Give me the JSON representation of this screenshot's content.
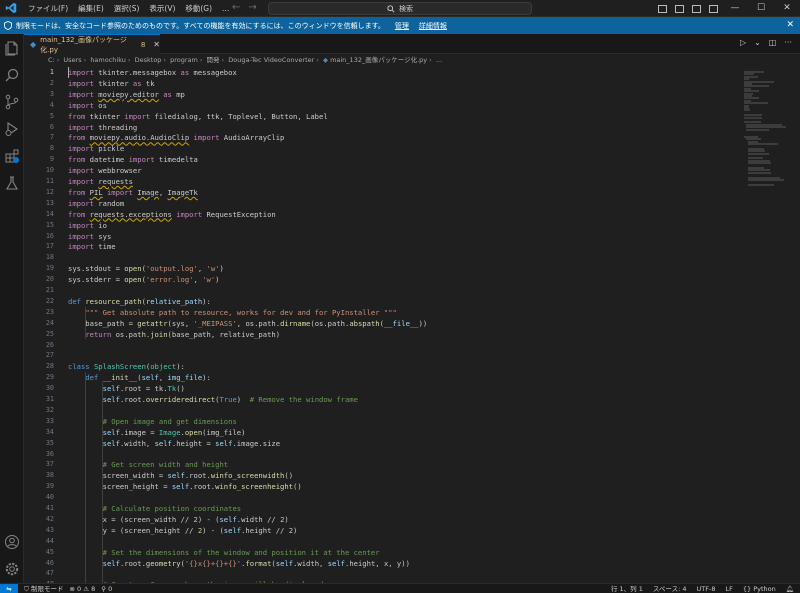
{
  "titlebar": {
    "menus": [
      "ファイル(F)",
      "編集(E)",
      "選択(S)",
      "表示(V)",
      "移動(G)",
      "..."
    ],
    "search_placeholder": "検索"
  },
  "banner": {
    "text": "制限モードは、安全なコード参照のためのものです。すべての機能を有効にするには、このウィンドウを信頼します。",
    "manage": "管理",
    "details": "詳細情報"
  },
  "tab": {
    "filename": "main_132_画像パッケージ化.py",
    "problems": "8"
  },
  "breadcrumb": [
    "C:",
    "Users",
    "hamochiku",
    "Desktop",
    "program",
    "開発",
    "Douga-Tec VideoConverter",
    "main_132_画像パッケージ化.py",
    "..."
  ],
  "editor": {
    "first_line_number": 1,
    "lines": [
      [
        [
          "import",
          "k"
        ],
        [
          " tkinter.messagebox ",
          ""
        ],
        [
          "as",
          "k"
        ],
        [
          " messagebox",
          ""
        ]
      ],
      [
        [
          "import",
          "k"
        ],
        [
          " tkinter ",
          ""
        ],
        [
          "as",
          "k"
        ],
        [
          " tk",
          ""
        ]
      ],
      [
        [
          "import",
          "k"
        ],
        [
          " ",
          ""
        ],
        [
          "moviepy.editor",
          "sq"
        ],
        [
          " ",
          ""
        ],
        [
          "as",
          "k"
        ],
        [
          " mp",
          ""
        ]
      ],
      [
        [
          "import",
          "k"
        ],
        [
          " os",
          ""
        ]
      ],
      [
        [
          "from",
          "k"
        ],
        [
          " tkinter ",
          ""
        ],
        [
          "import",
          "k"
        ],
        [
          " filedialog, ttk, Toplevel, Button, Label",
          ""
        ]
      ],
      [
        [
          "import",
          "k"
        ],
        [
          " threading",
          ""
        ]
      ],
      [
        [
          "from",
          "k"
        ],
        [
          " ",
          ""
        ],
        [
          "moviepy.audio.AudioClip",
          "sq"
        ],
        [
          " ",
          ""
        ],
        [
          "import",
          "k"
        ],
        [
          " AudioArrayClip",
          ""
        ]
      ],
      [
        [
          "import",
          "k"
        ],
        [
          " pickle",
          ""
        ]
      ],
      [
        [
          "from",
          "k"
        ],
        [
          " datetime ",
          ""
        ],
        [
          "import",
          "k"
        ],
        [
          " timedelta",
          ""
        ]
      ],
      [
        [
          "import",
          "k"
        ],
        [
          " webbrowser",
          ""
        ]
      ],
      [
        [
          "import",
          "k"
        ],
        [
          " ",
          ""
        ],
        [
          "requests",
          "sq"
        ]
      ],
      [
        [
          "from",
          "k"
        ],
        [
          " ",
          ""
        ],
        [
          "PIL",
          "sq"
        ],
        [
          " ",
          ""
        ],
        [
          "import",
          "k"
        ],
        [
          " ",
          ""
        ],
        [
          "Image",
          "sq"
        ],
        [
          ", ",
          ""
        ],
        [
          "ImageTk",
          "sq"
        ]
      ],
      [
        [
          "import",
          "k"
        ],
        [
          " random",
          ""
        ]
      ],
      [
        [
          "from",
          "k"
        ],
        [
          " ",
          ""
        ],
        [
          "requests.exceptions",
          "sq"
        ],
        [
          " ",
          ""
        ],
        [
          "import",
          "k"
        ],
        [
          " RequestException",
          ""
        ]
      ],
      [
        [
          "import",
          "k"
        ],
        [
          " io",
          ""
        ]
      ],
      [
        [
          "import",
          "k"
        ],
        [
          " sys",
          ""
        ]
      ],
      [
        [
          "import",
          "k"
        ],
        [
          " time",
          ""
        ]
      ],
      [],
      [
        [
          "sys.stdout = ",
          ""
        ],
        [
          "open",
          "f"
        ],
        [
          "(",
          ""
        ],
        [
          "'output.log'",
          "s"
        ],
        [
          ", ",
          ""
        ],
        [
          "'w'",
          "s"
        ],
        [
          ")",
          ""
        ]
      ],
      [
        [
          "sys.stderr = ",
          ""
        ],
        [
          "open",
          "f"
        ],
        [
          "(",
          ""
        ],
        [
          "'error.log'",
          "s"
        ],
        [
          ", ",
          ""
        ],
        [
          "'w'",
          "s"
        ],
        [
          ")",
          ""
        ]
      ],
      [],
      [
        [
          "def",
          "b"
        ],
        [
          " ",
          ""
        ],
        [
          "resource_path",
          "f"
        ],
        [
          "(",
          ""
        ],
        [
          "relative_path",
          "v"
        ],
        [
          "):",
          ""
        ]
      ],
      [
        [
          "    ",
          ""
        ],
        [
          "\"\"\" Get absolute path to resource, works for dev and for PyInstaller \"\"\"",
          "s"
        ]
      ],
      [
        [
          "    base_path = ",
          ""
        ],
        [
          "getattr",
          "f"
        ],
        [
          "(sys, ",
          ""
        ],
        [
          "'_MEIPASS'",
          "s"
        ],
        [
          ", os.path.",
          ""
        ],
        [
          "dirname",
          "f"
        ],
        [
          "(os.path.",
          ""
        ],
        [
          "abspath",
          "f"
        ],
        [
          "(",
          ""
        ],
        [
          "__file__",
          "v"
        ],
        [
          "))",
          ""
        ]
      ],
      [
        [
          "    ",
          ""
        ],
        [
          "return",
          "k"
        ],
        [
          " os.path.",
          ""
        ],
        [
          "join",
          "f"
        ],
        [
          "(base_path, relative_path)",
          ""
        ]
      ],
      [],
      [],
      [
        [
          "class",
          "b"
        ],
        [
          " ",
          ""
        ],
        [
          "SplashScreen",
          "c"
        ],
        [
          "(",
          ""
        ],
        [
          "object",
          "c"
        ],
        [
          "):",
          ""
        ]
      ],
      [
        [
          "    ",
          ""
        ],
        [
          "def",
          "b"
        ],
        [
          " ",
          ""
        ],
        [
          "__init__",
          "f"
        ],
        [
          "(",
          ""
        ],
        [
          "self",
          "v"
        ],
        [
          ", ",
          ""
        ],
        [
          "img_file",
          "v"
        ],
        [
          "):",
          ""
        ]
      ],
      [
        [
          "        ",
          ""
        ],
        [
          "self",
          "v"
        ],
        [
          ".root = tk.",
          ""
        ],
        [
          "Tk",
          "c"
        ],
        [
          "()",
          ""
        ]
      ],
      [
        [
          "        ",
          ""
        ],
        [
          "self",
          "v"
        ],
        [
          ".root.",
          ""
        ],
        [
          "overrideredirect",
          "f"
        ],
        [
          "(",
          ""
        ],
        [
          "True",
          "b"
        ],
        [
          ")  ",
          ""
        ],
        [
          "# Remove the window frame",
          "m"
        ]
      ],
      [],
      [
        [
          "        ",
          ""
        ],
        [
          "# Open image and get dimensions",
          "m"
        ]
      ],
      [
        [
          "        ",
          ""
        ],
        [
          "self",
          "v"
        ],
        [
          ".image = ",
          ""
        ],
        [
          "Image",
          "c"
        ],
        [
          ".",
          ""
        ],
        [
          "open",
          "f"
        ],
        [
          "(img_file)",
          ""
        ]
      ],
      [
        [
          "        ",
          ""
        ],
        [
          "self",
          "v"
        ],
        [
          ".width, ",
          ""
        ],
        [
          "self",
          "v"
        ],
        [
          ".height = ",
          ""
        ],
        [
          "self",
          "v"
        ],
        [
          ".image.size",
          ""
        ]
      ],
      [],
      [
        [
          "        ",
          ""
        ],
        [
          "# Get screen width and height",
          "m"
        ]
      ],
      [
        [
          "        screen_width = ",
          ""
        ],
        [
          "self",
          "v"
        ],
        [
          ".root.",
          ""
        ],
        [
          "winfo_screenwidth",
          "f"
        ],
        [
          "()",
          ""
        ]
      ],
      [
        [
          "        screen_height = ",
          ""
        ],
        [
          "self",
          "v"
        ],
        [
          ".root.",
          ""
        ],
        [
          "winfo_screenheight",
          "f"
        ],
        [
          "()",
          ""
        ]
      ],
      [],
      [
        [
          "        ",
          ""
        ],
        [
          "# Calculate position coordinates",
          "m"
        ]
      ],
      [
        [
          "        x = (screen_width // ",
          ""
        ],
        [
          "2",
          "n"
        ],
        [
          ") - (",
          ""
        ],
        [
          "self",
          "v"
        ],
        [
          ".width // ",
          ""
        ],
        [
          "2",
          "n"
        ],
        [
          ")",
          ""
        ]
      ],
      [
        [
          "        y = (screen_height // ",
          ""
        ],
        [
          "2",
          "n"
        ],
        [
          ") - (",
          ""
        ],
        [
          "self",
          "v"
        ],
        [
          ".height // ",
          ""
        ],
        [
          "2",
          "n"
        ],
        [
          ")",
          ""
        ]
      ],
      [],
      [
        [
          "        ",
          ""
        ],
        [
          "# Set the dimensions of the window and position it at the center",
          "m"
        ]
      ],
      [
        [
          "        ",
          ""
        ],
        [
          "self",
          "v"
        ],
        [
          ".root.",
          ""
        ],
        [
          "geometry",
          "f"
        ],
        [
          "(",
          ""
        ],
        [
          "'{}x{}+{}+{}'",
          "s"
        ],
        [
          ".",
          ""
        ],
        [
          "format",
          "f"
        ],
        [
          "(",
          ""
        ],
        [
          "self",
          "v"
        ],
        [
          ".width, ",
          ""
        ],
        [
          "self",
          "v"
        ],
        [
          ".height, x, y))",
          ""
        ]
      ],
      [],
      [
        [
          "        ",
          ""
        ],
        [
          "# Create a Canvas where the image will be displayed",
          "m"
        ]
      ]
    ]
  },
  "statusbar": {
    "restricted": "制限モード",
    "errors": "0",
    "warnings": "8",
    "ports": "0",
    "cursor": "行 1、列 1",
    "spaces": "スペース: 4",
    "encoding": "UTF-8",
    "eol": "LF",
    "language": "Python"
  }
}
